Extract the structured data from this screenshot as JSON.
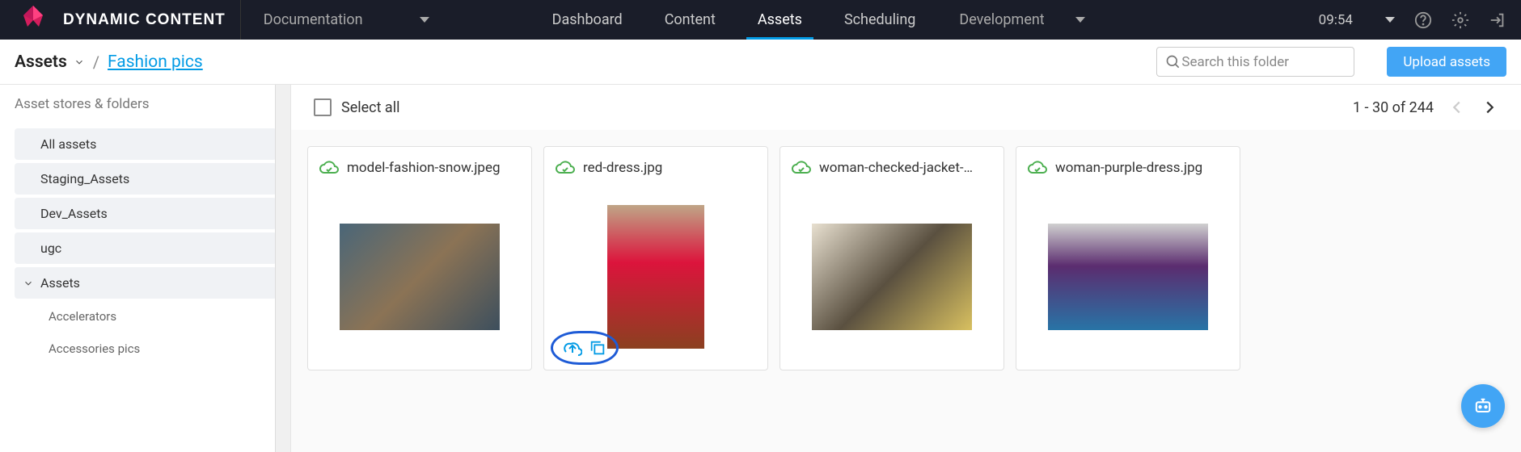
{
  "header": {
    "logo_text": "DYNAMIC CONTENT",
    "doc_label": "Documentation",
    "tabs": [
      "Dashboard",
      "Content",
      "Assets",
      "Scheduling"
    ],
    "active_tab": "Assets",
    "dev_label": "Development",
    "clock": "09:54"
  },
  "breadcrumb": {
    "root": "Assets",
    "current": "Fashion pics"
  },
  "search": {
    "placeholder": "Search this folder"
  },
  "upload_label": "Upload assets",
  "sidebar": {
    "title": "Asset stores & folders",
    "items": [
      "All assets",
      "Staging_Assets",
      "Dev_Assets",
      "ugc",
      "Assets"
    ],
    "sub_items": [
      "Accelerators",
      "Accessories pics"
    ]
  },
  "toolbar": {
    "select_all": "Select all",
    "range": "1 - 30 of 244"
  },
  "assets": [
    {
      "name": "model-fashion-snow.jpeg"
    },
    {
      "name": "red-dress.jpg"
    },
    {
      "name": "woman-checked-jacket-…"
    },
    {
      "name": "woman-purple-dress.jpg"
    }
  ]
}
